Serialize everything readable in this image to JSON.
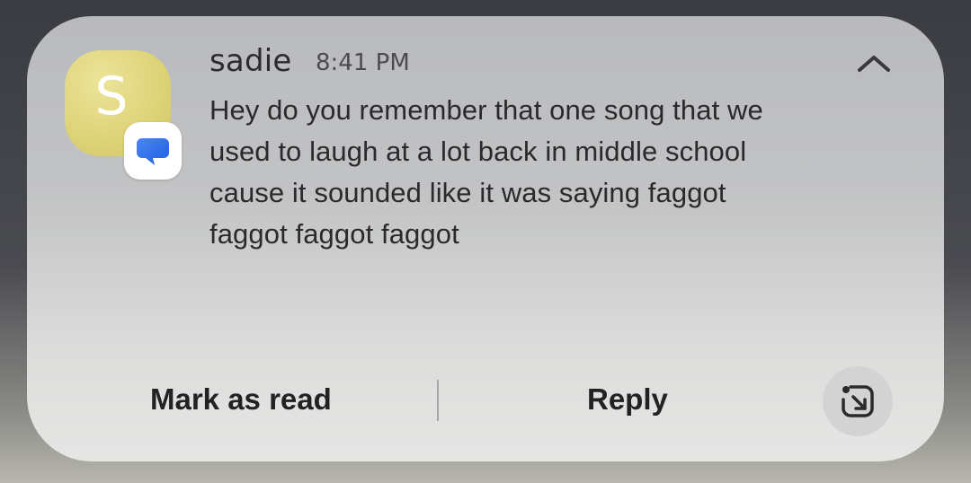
{
  "notification": {
    "avatar_letter": "S",
    "avatar_color": "#ddd276",
    "app_badge_icon": "chat-bubble-icon",
    "app_badge_color": "#2f6ff0",
    "sender": "sadie",
    "time": "8:41 PM",
    "message": "Hey do you remember that one song that we used to laugh at a lot back in middle school cause it sounded like it was saying faggot faggot faggot faggot",
    "collapse_icon": "chevron-up-icon"
  },
  "actions": {
    "mark_as_read": "Mark as read",
    "reply": "Reply",
    "expand_icon": "open-in-window-icon"
  }
}
